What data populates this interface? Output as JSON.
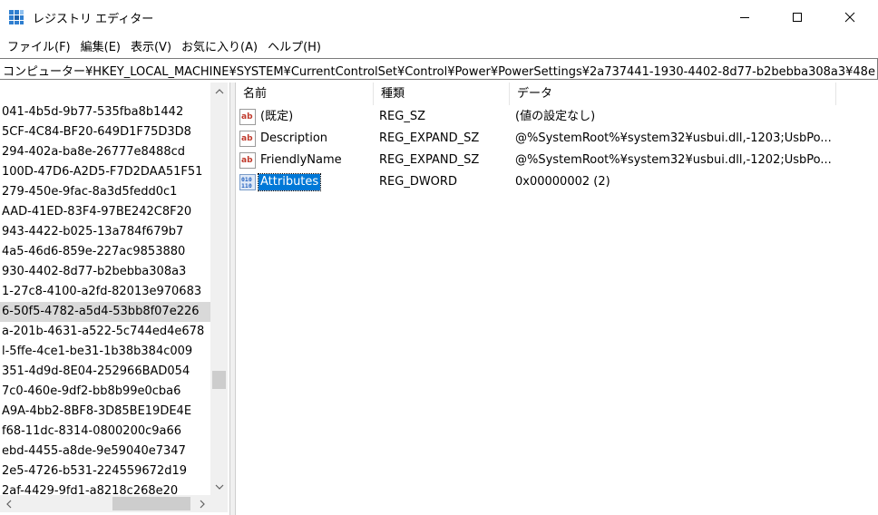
{
  "window": {
    "title": "レジストリ エディター"
  },
  "menu": [
    {
      "label": "ファイル(F)"
    },
    {
      "label": "編集(E)"
    },
    {
      "label": "表示(V)"
    },
    {
      "label": "お気に入り(A)"
    },
    {
      "label": "ヘルプ(H)"
    }
  ],
  "address": "コンピューター¥HKEY_LOCAL_MACHINE¥SYSTEM¥CurrentControlSet¥Control¥Power¥PowerSettings¥2a737441-1930-4402-8d77-b2bebba308a3¥48e",
  "tree": {
    "items": [
      {
        "label": "041-4b5d-9b77-535fba8b1442"
      },
      {
        "label": "5CF-4C84-BF20-649D1F75D3D8"
      },
      {
        "label": "294-402a-ba8e-26777e8488cd"
      },
      {
        "label": "100D-47D6-A2D5-F7D2DAA51F51"
      },
      {
        "label": "279-450e-9fac-8a3d5fedd0c1"
      },
      {
        "label": "AAD-41ED-83F4-97BE242C8F20"
      },
      {
        "label": "943-4422-b025-13a784f679b7"
      },
      {
        "label": "4a5-46d6-859e-227ac9853880"
      },
      {
        "label": "930-4402-8d77-b2bebba308a3"
      },
      {
        "label": "1-27c8-4100-a2fd-82013e970683"
      },
      {
        "label": "6-50f5-4782-a5d4-53bb8f07e226",
        "selected": true
      },
      {
        "label": "a-201b-4631-a522-5c744ed4e678"
      },
      {
        "label": "l-5ffe-4ce1-be31-1b38b384c009"
      },
      {
        "label": "351-4d9d-8E04-252966BAD054"
      },
      {
        "label": "7c0-460e-9df2-bb8b99e0cba6"
      },
      {
        "label": "A9A-4bb2-8BF8-3D85BE19DE4E"
      },
      {
        "label": "f68-11dc-8314-0800200c9a66"
      },
      {
        "label": "ebd-4455-a8de-9e59040e7347"
      },
      {
        "label": "2e5-4726-b531-224559672d19"
      },
      {
        "label": "2af-4429-9fd1-a8218c268e20"
      }
    ]
  },
  "list": {
    "columns": [
      "名前",
      "種類",
      "データ"
    ],
    "rows": [
      {
        "name": "(既定)",
        "type": "REG_SZ",
        "data": "(値の設定なし)",
        "icon": "string-value-icon"
      },
      {
        "name": "Description",
        "type": "REG_EXPAND_SZ",
        "data": "@%SystemRoot%¥system32¥usbui.dll,-1203;UsbPo...",
        "icon": "string-value-icon"
      },
      {
        "name": "FriendlyName",
        "type": "REG_EXPAND_SZ",
        "data": "@%SystemRoot%¥system32¥usbui.dll,-1202;UsbPo...",
        "icon": "string-value-icon"
      },
      {
        "name": "Attributes",
        "type": "REG_DWORD",
        "data": "0x00000002 (2)",
        "icon": "binary-value-icon",
        "selected": true
      }
    ]
  },
  "colors": {
    "selection": "#0078d7",
    "tree_selection": "#d9d9d9",
    "scrollbar": "#f0f0f0",
    "string_icon": "#c0392b",
    "binary_icon": "#1f5fbf"
  }
}
